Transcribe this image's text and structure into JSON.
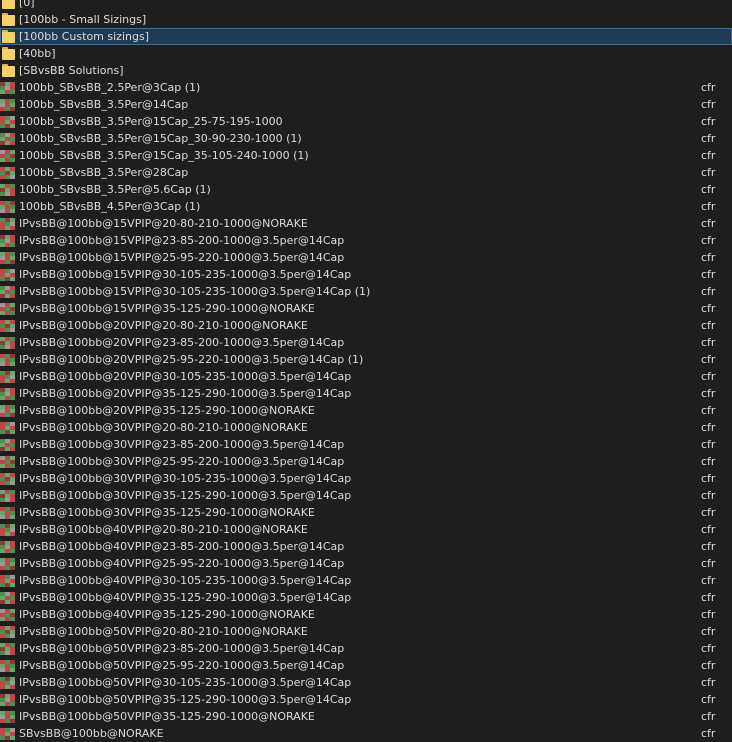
{
  "folders": [
    {
      "label": "[0]"
    },
    {
      "label": "[100bb - Small Sizings]"
    },
    {
      "label": "[100bb Custom sizings]",
      "selected": true
    },
    {
      "label": "[40bb]"
    },
    {
      "label": "[SBvsBB Solutions]"
    }
  ],
  "files": [
    {
      "name": "100bb_SBvsBB_2.5Per@3Cap (1)",
      "type": "cfr"
    },
    {
      "name": "100bb_SBvsBB_3.5Per@14Cap",
      "type": "cfr"
    },
    {
      "name": "100bb_SBvsBB_3.5Per@15Cap_25-75-195-1000",
      "type": "cfr"
    },
    {
      "name": "100bb_SBvsBB_3.5Per@15Cap_30-90-230-1000 (1)",
      "type": "cfr"
    },
    {
      "name": "100bb_SBvsBB_3.5Per@15Cap_35-105-240-1000 (1)",
      "type": "cfr"
    },
    {
      "name": "100bb_SBvsBB_3.5Per@28Cap",
      "type": "cfr"
    },
    {
      "name": "100bb_SBvsBB_3.5Per@5.6Cap (1)",
      "type": "cfr"
    },
    {
      "name": "100bb_SBvsBB_4.5Per@3Cap (1)",
      "type": "cfr"
    },
    {
      "name": "IPvsBB@100bb@15VPIP@20-80-210-1000@NORAKE",
      "type": "cfr"
    },
    {
      "name": "IPvsBB@100bb@15VPIP@23-85-200-1000@3.5per@14Cap",
      "type": "cfr"
    },
    {
      "name": "IPvsBB@100bb@15VPIP@25-95-220-1000@3.5per@14Cap",
      "type": "cfr"
    },
    {
      "name": "IPvsBB@100bb@15VPIP@30-105-235-1000@3.5per@14Cap",
      "type": "cfr"
    },
    {
      "name": "IPvsBB@100bb@15VPIP@30-105-235-1000@3.5per@14Cap (1)",
      "type": "cfr"
    },
    {
      "name": "IPvsBB@100bb@15VPIP@35-125-290-1000@NORAKE",
      "type": "cfr"
    },
    {
      "name": "IPvsBB@100bb@20VPIP@20-80-210-1000@NORAKE",
      "type": "cfr"
    },
    {
      "name": "IPvsBB@100bb@20VPIP@23-85-200-1000@3.5per@14Cap",
      "type": "cfr"
    },
    {
      "name": "IPvsBB@100bb@20VPIP@25-95-220-1000@3.5per@14Cap (1)",
      "type": "cfr"
    },
    {
      "name": "IPvsBB@100bb@20VPIP@30-105-235-1000@3.5per@14Cap",
      "type": "cfr"
    },
    {
      "name": "IPvsBB@100bb@20VPIP@35-125-290-1000@3.5per@14Cap",
      "type": "cfr"
    },
    {
      "name": "IPvsBB@100bb@20VPIP@35-125-290-1000@NORAKE",
      "type": "cfr"
    },
    {
      "name": "IPvsBB@100bb@30VPIP@20-80-210-1000@NORAKE",
      "type": "cfr"
    },
    {
      "name": "IPvsBB@100bb@30VPIP@23-85-200-1000@3.5per@14Cap",
      "type": "cfr"
    },
    {
      "name": "IPvsBB@100bb@30VPIP@25-95-220-1000@3.5per@14Cap",
      "type": "cfr"
    },
    {
      "name": "IPvsBB@100bb@30VPIP@30-105-235-1000@3.5per@14Cap",
      "type": "cfr"
    },
    {
      "name": "IPvsBB@100bb@30VPIP@35-125-290-1000@3.5per@14Cap",
      "type": "cfr"
    },
    {
      "name": "IPvsBB@100bb@30VPIP@35-125-290-1000@NORAKE",
      "type": "cfr"
    },
    {
      "name": "IPvsBB@100bb@40VPIP@20-80-210-1000@NORAKE",
      "type": "cfr"
    },
    {
      "name": "IPvsBB@100bb@40VPIP@23-85-200-1000@3.5per@14Cap",
      "type": "cfr"
    },
    {
      "name": "IPvsBB@100bb@40VPIP@25-95-220-1000@3.5per@14Cap",
      "type": "cfr"
    },
    {
      "name": "IPvsBB@100bb@40VPIP@30-105-235-1000@3.5per@14Cap",
      "type": "cfr"
    },
    {
      "name": "IPvsBB@100bb@40VPIP@35-125-290-1000@3.5per@14Cap",
      "type": "cfr"
    },
    {
      "name": "IPvsBB@100bb@40VPIP@35-125-290-1000@NORAKE",
      "type": "cfr"
    },
    {
      "name": "IPvsBB@100bb@50VPIP@20-80-210-1000@NORAKE",
      "type": "cfr"
    },
    {
      "name": "IPvsBB@100bb@50VPIP@23-85-200-1000@3.5per@14Cap",
      "type": "cfr"
    },
    {
      "name": "IPvsBB@100bb@50VPIP@25-95-220-1000@3.5per@14Cap",
      "type": "cfr"
    },
    {
      "name": "IPvsBB@100bb@50VPIP@30-105-235-1000@3.5per@14Cap",
      "type": "cfr"
    },
    {
      "name": "IPvsBB@100bb@50VPIP@35-125-290-1000@3.5per@14Cap",
      "type": "cfr"
    },
    {
      "name": "IPvsBB@100bb@50VPIP@35-125-290-1000@NORAKE",
      "type": "cfr"
    },
    {
      "name": "SBvsBB@100bb@NORAKE",
      "type": "cfr"
    }
  ],
  "icons": {
    "folder": "folder-icon",
    "file": "solution-grid-icon"
  },
  "colors": {
    "background": "#1e1e1e",
    "text": "#dcdcdc",
    "selection_bg": "#1f3a55",
    "selection_border": "#3c6d9e",
    "folder": "#f5cf68"
  }
}
